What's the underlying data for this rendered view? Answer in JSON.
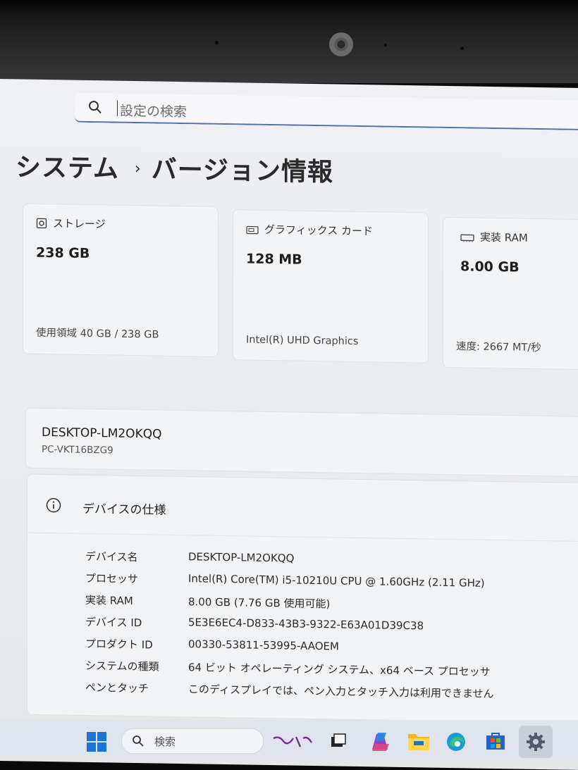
{
  "search": {
    "placeholder": "設定の検索"
  },
  "breadcrumb": {
    "parent": "システム",
    "separator": "›",
    "current": "バージョン情報"
  },
  "cards": [
    {
      "label": "ストレージ",
      "value": "238 GB",
      "sub": "使用領域 40 GB / 238 GB",
      "icon": "storage-icon"
    },
    {
      "label": "グラフィックス カード",
      "value": "128 MB",
      "sub": "Intel(R) UHD Graphics",
      "icon": "graphics-card-icon"
    },
    {
      "label": "実装 RAM",
      "value": "8.00 GB",
      "sub": "速度: 2667 MT/秒",
      "icon": "ram-icon"
    }
  ],
  "device": {
    "name": "DESKTOP-LM2OKQQ",
    "model": "PC-VKT16BZG9"
  },
  "specs": {
    "title": "デバイスの仕様",
    "rows": [
      {
        "key": "デバイス名",
        "value": "DESKTOP-LM2OKQQ"
      },
      {
        "key": "プロセッサ",
        "value": "Intel(R) Core(TM) i5-10210U CPU @ 1.60GHz (2.11 GHz)"
      },
      {
        "key": "実装 RAM",
        "value": "8.00 GB (7.76 GB 使用可能)"
      },
      {
        "key": "デバイス ID",
        "value": "5E3E6EC4-D833-43B3-9322-E63A01D39C38"
      },
      {
        "key": "プロダクト ID",
        "value": "00330-53811-53995-AAOEM"
      },
      {
        "key": "システムの種類",
        "value": "64 ビット オペレーティング システム、x64 ベース プロセッサ"
      },
      {
        "key": "ペンとタッチ",
        "value": "このディスプレイでは、ペン入力とタッチ入力は利用できません"
      }
    ]
  },
  "taskbar": {
    "search_label": "検索",
    "accent": "#0078d4"
  }
}
